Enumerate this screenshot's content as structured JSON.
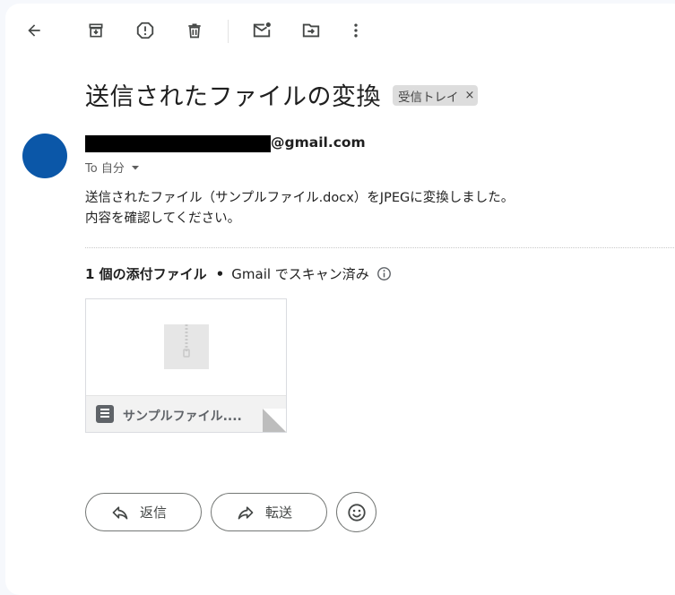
{
  "toolbar": {
    "icons": [
      "back-arrow-icon",
      "archive-icon",
      "report-spam-icon",
      "delete-icon",
      "mark-unread-icon",
      "move-to-icon",
      "more-vert-icon"
    ]
  },
  "email": {
    "subject": "送信されたファイルの変換",
    "label": "受信トレイ",
    "label_close": "×",
    "sender_domain": "@gmail.com",
    "to_text": "To 自分",
    "body_line1": "送信されたファイル（サンプルファイル.docx）をJPEGに変換しました。",
    "body_line2": "内容を確認してください。"
  },
  "attachments": {
    "count_label": "1 個の添付ファイル",
    "separator": "•",
    "scan_label": "Gmail でスキャン済み",
    "items": [
      {
        "name": "サンプルファイル...."
      }
    ]
  },
  "actions": {
    "reply_label": "返信",
    "forward_label": "転送"
  },
  "colors": {
    "avatar": "#0b57a8",
    "chip_bg": "#dddddd"
  }
}
